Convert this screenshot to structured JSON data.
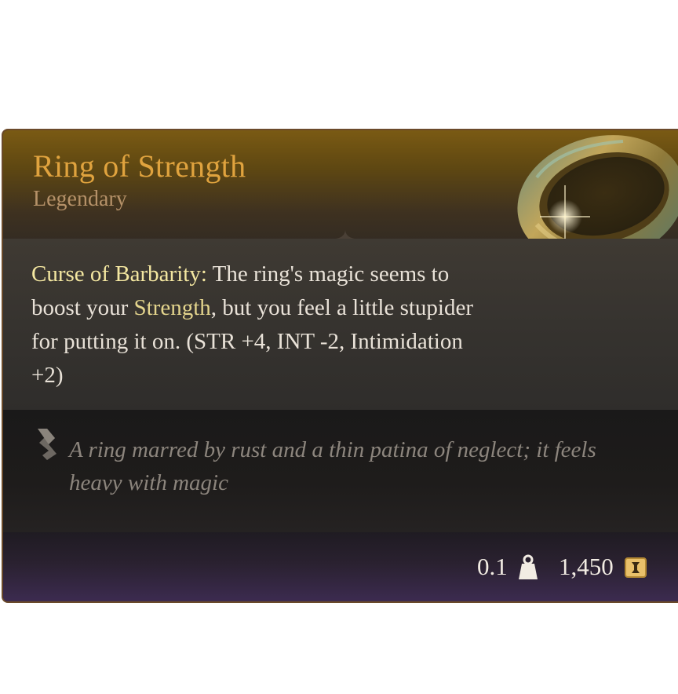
{
  "item": {
    "name": "Ring of Strength",
    "rarity": "Legendary"
  },
  "description": {
    "keyword": "Curse of Barbarity:",
    "part1": " The ring's magic seems to boost your ",
    "highlight": "Strength",
    "part2": ", but you feel a little stupider for putting it on. (STR +4, INT -2, Intimidation +2)"
  },
  "lore": {
    "text": "A ring marred by rust and a thin patina of neglect; it feels heavy with magic",
    "icon": "quill-icon"
  },
  "footer": {
    "weight": "0.1",
    "weight_icon": "weight-icon",
    "price": "1,450",
    "price_icon": "gold-coin-icon"
  },
  "colors": {
    "title": "#e0a33e",
    "rarity": "#b59168",
    "keyword": "#f4e7a1",
    "highlight": "#e4d58d",
    "lore": "#8c857d",
    "border": "#6b4a2a"
  }
}
